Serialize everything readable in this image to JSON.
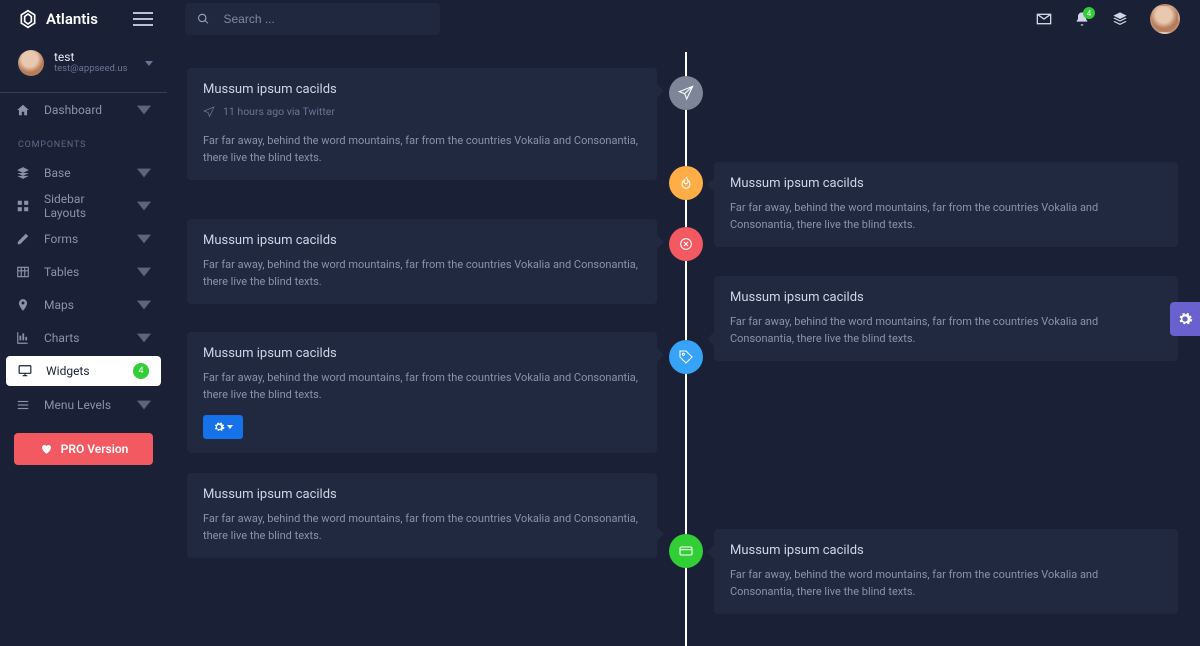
{
  "brand": "Atlantis",
  "search": {
    "placeholder": "Search ..."
  },
  "notif_count": "4",
  "user": {
    "name": "test",
    "email": "test@appseed.us"
  },
  "sidebar": {
    "dashboard": "Dashboard",
    "section": "COMPONENTS",
    "base": "Base",
    "layouts": "Sidebar Layouts",
    "forms": "Forms",
    "tables": "Tables",
    "maps": "Maps",
    "charts": "Charts",
    "widgets": "Widgets",
    "widgets_badge": "4",
    "menulevels": "Menu Levels",
    "pro": "PRO Version"
  },
  "cards": {
    "title": "Mussum ipsum cacilds",
    "meta": "11 hours ago via Twitter",
    "body": "Far far away, behind the word mountains, far from the countries Vokalia and Consonantia, there live the blind texts."
  }
}
